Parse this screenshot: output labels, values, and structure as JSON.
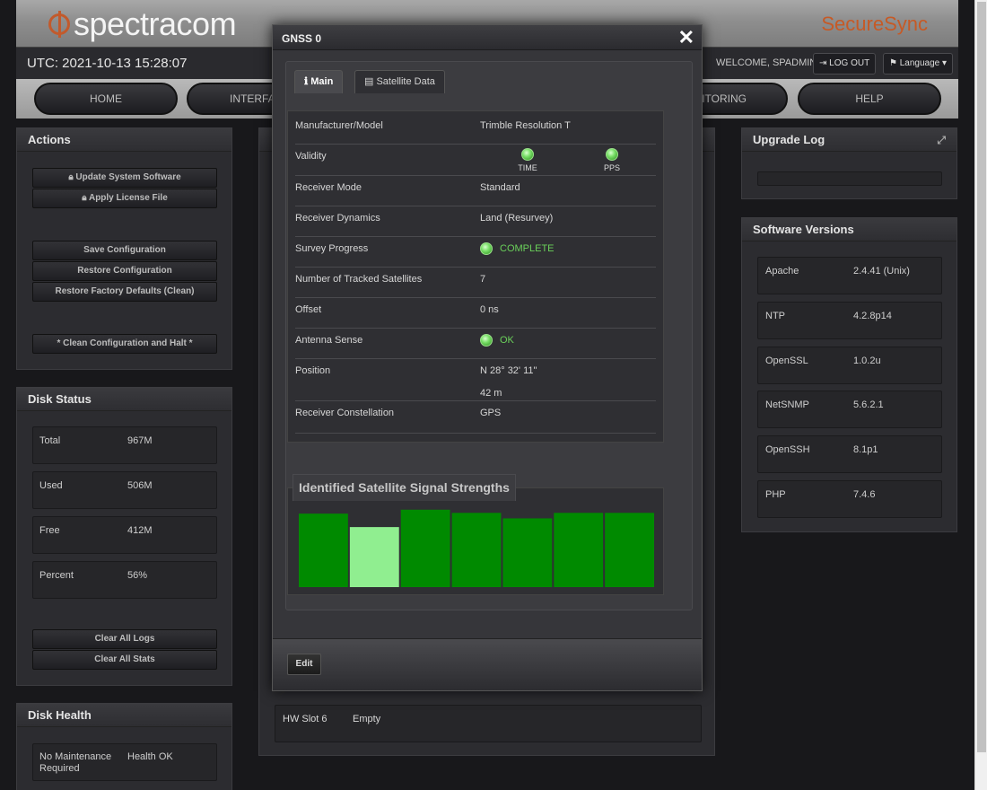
{
  "header": {
    "logo_text": "spectracom",
    "brand": "SecureSync",
    "utc": "UTC: 2021-10-13 15:28:07",
    "welcome": "WELCOME, SPADMIN",
    "logout": "LOG OUT",
    "language": "Language"
  },
  "nav": {
    "home": "HOME",
    "interfaces": "INTERFACES",
    "monitoring": "MONITORING",
    "help": "HELP"
  },
  "actions": {
    "title": "Actions",
    "update": "Update System Software",
    "license": "Apply License File",
    "save": "Save Configuration",
    "restore": "Restore Configuration",
    "factory": "Restore Factory Defaults (Clean)",
    "halt": "* Clean Configuration and Halt *"
  },
  "disk_status": {
    "title": "Disk Status",
    "rows": [
      {
        "k": "Total",
        "v": "967M"
      },
      {
        "k": "Used",
        "v": "506M"
      },
      {
        "k": "Free",
        "v": "412M"
      },
      {
        "k": "Percent",
        "v": "56%"
      }
    ],
    "clear_logs": "Clear All Logs",
    "clear_stats": "Clear All Stats"
  },
  "disk_health": {
    "title": "Disk Health",
    "k": "No Maintenance Required",
    "v": "Health OK"
  },
  "upgrade_log": {
    "title": "Upgrade Log"
  },
  "software": {
    "title": "Software Versions",
    "rows": [
      {
        "k": "Apache",
        "v": "2.4.41 (Unix)"
      },
      {
        "k": "NTP",
        "v": "4.2.8p14"
      },
      {
        "k": "OpenSSL",
        "v": "1.0.2u"
      },
      {
        "k": "NetSNMP",
        "v": "5.6.2.1"
      },
      {
        "k": "OpenSSH",
        "v": "8.1p1"
      },
      {
        "k": "PHP",
        "v": "7.4.6"
      }
    ]
  },
  "hwslot": {
    "k": "HW Slot 6",
    "v": "Empty"
  },
  "modal": {
    "title": "GNSS 0",
    "tab_main": "Main",
    "tab_sat": "Satellite Data",
    "rows": {
      "manufacturer_k": "Manufacturer/Model",
      "manufacturer_v": "Trimble Resolution T",
      "validity_k": "Validity",
      "validity_time": "TIME",
      "validity_pps": "PPS",
      "mode_k": "Receiver Mode",
      "mode_v": "Standard",
      "dynamics_k": "Receiver Dynamics",
      "dynamics_v": "Land (Resurvey)",
      "survey_k": "Survey Progress",
      "survey_v": "COMPLETE",
      "tracked_k": "Number of Tracked Satellites",
      "tracked_v": "7",
      "offset_k": "Offset",
      "offset_v": "0 ns",
      "antenna_k": "Antenna Sense",
      "antenna_v": "OK",
      "position_k": "Position",
      "position_v1": "N 28° 32' 11\"",
      "position_v2": "42 m",
      "constellation_k": "Receiver Constellation",
      "constellation_v": "GPS"
    },
    "signal_title": "Identified Satellite Signal Strengths",
    "edit": "Edit"
  },
  "colors": {
    "bar_dark": "#008a00",
    "bar_light": "#90ee90",
    "brand": "#c65a26"
  },
  "chart_data": {
    "type": "bar",
    "categories": [
      "",
      "",
      "",
      "",
      "",
      "",
      ""
    ],
    "values": [
      0.93,
      0.76,
      0.98,
      0.94,
      0.87,
      0.94,
      0.94
    ],
    "highlight": [
      false,
      true,
      false,
      false,
      false,
      false,
      false
    ],
    "ylim": [
      0,
      1
    ]
  }
}
